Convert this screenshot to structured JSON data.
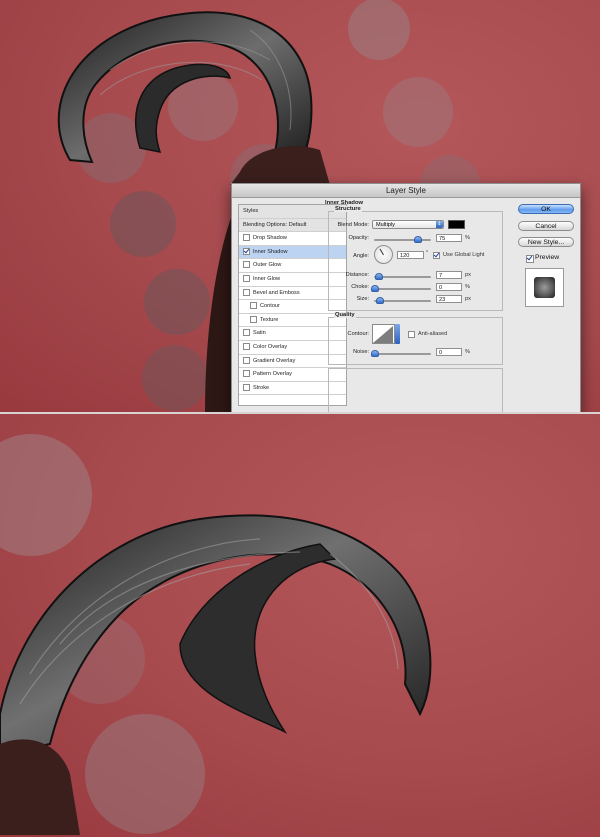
{
  "dialog": {
    "title": "Layer Style",
    "styles_list": [
      {
        "label": "Styles",
        "checkbox": false,
        "checked": false,
        "selected": false,
        "indent": false,
        "header": true
      },
      {
        "label": "Blending Options: Default",
        "checkbox": false,
        "checked": false,
        "selected": false,
        "indent": false,
        "header": true
      },
      {
        "label": "Drop Shadow",
        "checkbox": true,
        "checked": false,
        "selected": false,
        "indent": false
      },
      {
        "label": "Inner Shadow",
        "checkbox": true,
        "checked": true,
        "selected": true,
        "indent": false
      },
      {
        "label": "Outer Glow",
        "checkbox": true,
        "checked": false,
        "selected": false,
        "indent": false
      },
      {
        "label": "Inner Glow",
        "checkbox": true,
        "checked": false,
        "selected": false,
        "indent": false
      },
      {
        "label": "Bevel and Emboss",
        "checkbox": true,
        "checked": false,
        "selected": false,
        "indent": false
      },
      {
        "label": "Contour",
        "checkbox": true,
        "checked": false,
        "selected": false,
        "indent": true
      },
      {
        "label": "Texture",
        "checkbox": true,
        "checked": false,
        "selected": false,
        "indent": true
      },
      {
        "label": "Satin",
        "checkbox": true,
        "checked": false,
        "selected": false,
        "indent": false
      },
      {
        "label": "Color Overlay",
        "checkbox": true,
        "checked": false,
        "selected": false,
        "indent": false
      },
      {
        "label": "Gradient Overlay",
        "checkbox": true,
        "checked": false,
        "selected": false,
        "indent": false
      },
      {
        "label": "Pattern Overlay",
        "checkbox": true,
        "checked": false,
        "selected": false,
        "indent": false
      },
      {
        "label": "Stroke",
        "checkbox": true,
        "checked": false,
        "selected": false,
        "indent": false
      }
    ],
    "section_title": "Inner Shadow",
    "structure": {
      "group_title": "Structure",
      "blend_mode_label": "Blend Mode:",
      "blend_mode_value": "Multiply",
      "shadow_color": "#000000",
      "opacity_label": "Opacity:",
      "opacity_value": "75",
      "opacity_unit": "%",
      "opacity_fraction": 0.75,
      "angle_label": "Angle:",
      "angle_value": "120",
      "angle_unit": "°",
      "global_light_label": "Use Global Light",
      "global_light_checked": true,
      "distance_label": "Distance:",
      "distance_value": "7",
      "distance_unit": "px",
      "distance_fraction": 0.07,
      "choke_label": "Choke:",
      "choke_value": "0",
      "choke_unit": "%",
      "choke_fraction": 0.0,
      "size_label": "Size:",
      "size_value": "23",
      "size_unit": "px",
      "size_fraction": 0.08
    },
    "quality": {
      "group_title": "Quality",
      "contour_label": "Contour:",
      "anti_aliased_label": "Anti-aliased",
      "anti_aliased_checked": false,
      "noise_label": "Noise:",
      "noise_value": "0",
      "noise_unit": "%",
      "noise_fraction": 0.0
    },
    "buttons": {
      "ok": "OK",
      "cancel": "Cancel",
      "new_style": "New Style..."
    },
    "preview_label": "Preview",
    "preview_checked": true
  },
  "colors": {
    "background_red": "#a84a4e",
    "bokeh": "#8a6a6e",
    "selected_row": "#bcd3f2",
    "accent_blue": "#3a78d8"
  }
}
